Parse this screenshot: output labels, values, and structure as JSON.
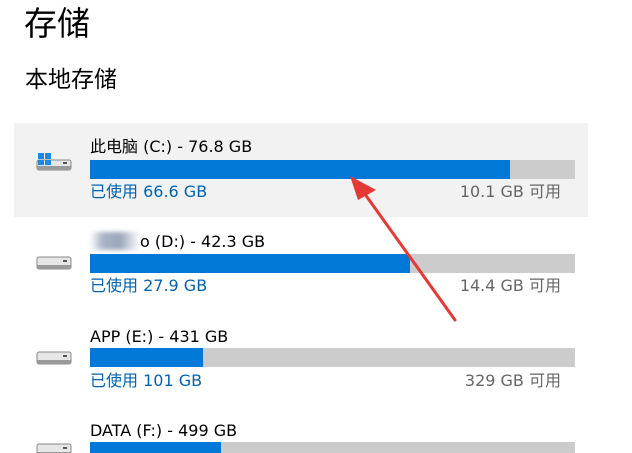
{
  "page": {
    "title": "存储",
    "section": "本地存储"
  },
  "drives": [
    {
      "name": "此电脑 (C:) - 76.8 GB",
      "used": "已使用 66.6 GB",
      "free": "10.1 GB 可用",
      "used_fraction": 0.867,
      "icon": "windows-drive-icon",
      "selected": true
    },
    {
      "name_suffix": "o (D:) - 42.3 GB",
      "used": "已使用 27.9 GB",
      "free": "14.4 GB 可用",
      "used_fraction": 0.66,
      "icon": "drive-icon"
    },
    {
      "name": "APP (E:) - 431 GB",
      "used": "已使用 101 GB",
      "free": "329 GB 可用",
      "used_fraction": 0.234,
      "icon": "drive-icon"
    },
    {
      "name": "DATA (F:) - 499 GB",
      "used_fraction": 0.27,
      "icon": "drive-icon"
    }
  ],
  "colors": {
    "accent": "#0078d7",
    "used_text": "#0063b1",
    "bar_background": "#cccccc",
    "annotation": "#e53935"
  }
}
